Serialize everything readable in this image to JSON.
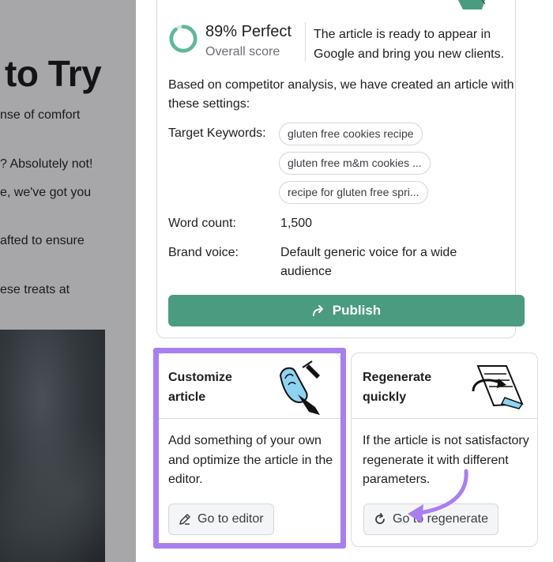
{
  "article": {
    "heading_fragment": "to Try",
    "text_fragments": [
      "nse of comfort",
      "? Absolutely not!",
      "e, we've got you",
      "afted to ensure",
      "ese treats at"
    ]
  },
  "score": {
    "percent": 89,
    "title": "89% Perfect",
    "subtitle": "Overall score",
    "message": "The article is ready to appear in Google and bring you new clients."
  },
  "settings": {
    "intro": "Based on competitor analysis, we have created an article with these settings:",
    "keywords_label": "Target Keywords:",
    "keywords": [
      "gluten free cookies recipe",
      "gluten free m&m cookies ...",
      "recipe for gluten free spri..."
    ],
    "word_count_label": "Word count:",
    "word_count": "1,500",
    "brand_voice_label": "Brand voice:",
    "brand_voice": "Default generic voice for a wide audience"
  },
  "publish": {
    "label": "Publish",
    "icon": "share-arrow-icon"
  },
  "customize_card": {
    "title_line1": "Customize",
    "title_line2": "article",
    "description": "Add something of your own and optimize the article in the editor.",
    "button_label": "Go to editor",
    "button_icon": "pencil-icon"
  },
  "regenerate_card": {
    "title_line1": "Regenerate",
    "title_line2": "quickly",
    "description": "If the article is not satisfactory regenerate it with different parameters.",
    "button_label": "Go to regenerate",
    "button_icon": "refresh-icon"
  },
  "colors": {
    "accent_green": "#4a9b7f",
    "highlight_purple": "#a97ff0",
    "score_ring": "#5fb89a"
  }
}
